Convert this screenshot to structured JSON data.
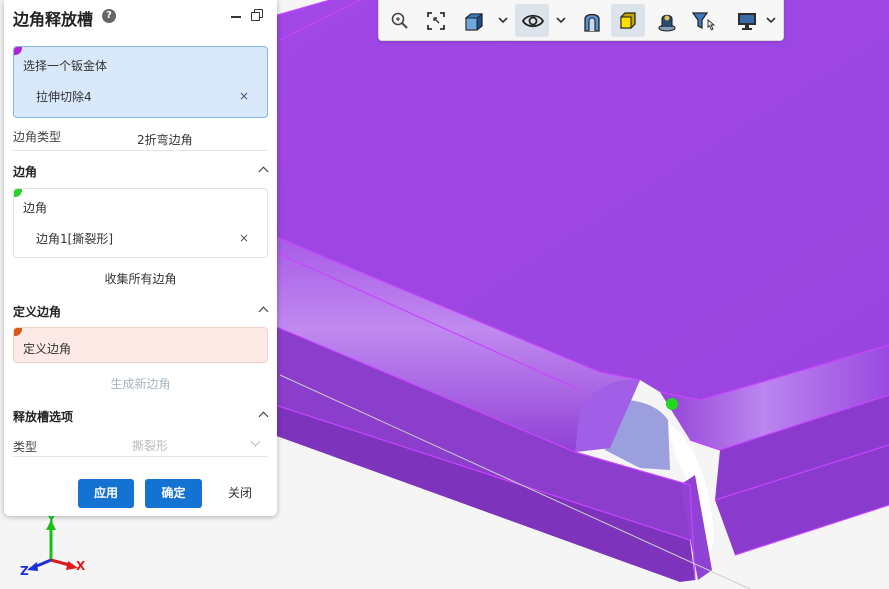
{
  "panel": {
    "title": "边角释放槽",
    "help_glyph": "?",
    "selection_body": {
      "label": "选择一个钣金体",
      "item": "拉伸切除4",
      "remove_glyph": "×"
    },
    "corner_type": {
      "label": "边角类型",
      "value": "2折弯边角"
    },
    "section_corners": {
      "title": "边角",
      "box_label": "边角",
      "item": "边角1[撕裂形]",
      "remove_glyph": "×",
      "collect_label": "收集所有边角"
    },
    "section_define": {
      "title": "定义边角",
      "box_label": "定义边角",
      "generate_label": "生成新边角"
    },
    "section_options": {
      "title": "释放槽选项",
      "type_label": "类型",
      "type_value": "撕裂形"
    },
    "buttons": {
      "apply": "应用",
      "ok": "确定",
      "close": "关闭"
    }
  },
  "axes": {
    "x": "X",
    "y": "Y",
    "z": "Z"
  },
  "colors": {
    "model": "#a54ae4",
    "model_dark": "#7a2fc0",
    "model_edge": "#c845ff",
    "primary": "#1472d2",
    "selected_box": "#d9e9fb",
    "define_box": "#fdeae6",
    "vertex": "#22d822"
  },
  "toolbar": {
    "icons": [
      "zoom-icon",
      "zoom-fit-icon",
      "view-cube-icon",
      "visibility-eye-icon",
      "section-view-icon",
      "shaded-display-icon",
      "appearance-icon",
      "selection-filter-icon",
      "display-settings-icon"
    ]
  }
}
